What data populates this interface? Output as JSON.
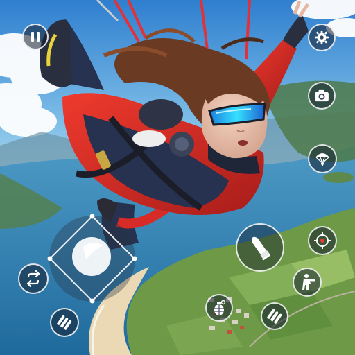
{
  "game": {
    "scene": "skydiver-freefall",
    "colors": {
      "sky_top": "#3f8fd4",
      "sky_mid": "#8ec6ea",
      "sea": "#2f7fb0",
      "land": "#6d9a4a",
      "sand": "#e7d6b0",
      "suit_red": "#d62b26",
      "suit_navy": "#26324f",
      "hair": "#6b3a22",
      "goggles": "#29c8f2",
      "hud_fill": "rgba(20,30,45,0.55)",
      "hud_stroke": "#ffffff"
    }
  },
  "hud": {
    "pause": {
      "icon": "pause-icon"
    },
    "settings": {
      "icon": "gear-icon"
    },
    "camera": {
      "icon": "camera-icon"
    },
    "parachute": {
      "icon": "parachute-icon"
    },
    "fire": {
      "icon": "bullet-icon"
    },
    "aim": {
      "icon": "crosshair-icon"
    },
    "soldier": {
      "icon": "soldier-icon"
    },
    "grenade": {
      "icon": "grenade-icon"
    },
    "ammo_right": {
      "icon": "ammo-icon"
    },
    "ammo_left": {
      "icon": "ammo-icon"
    },
    "swap": {
      "icon": "swap-arrows-icon"
    },
    "joystick": {
      "icon": "joystick-knob"
    }
  }
}
